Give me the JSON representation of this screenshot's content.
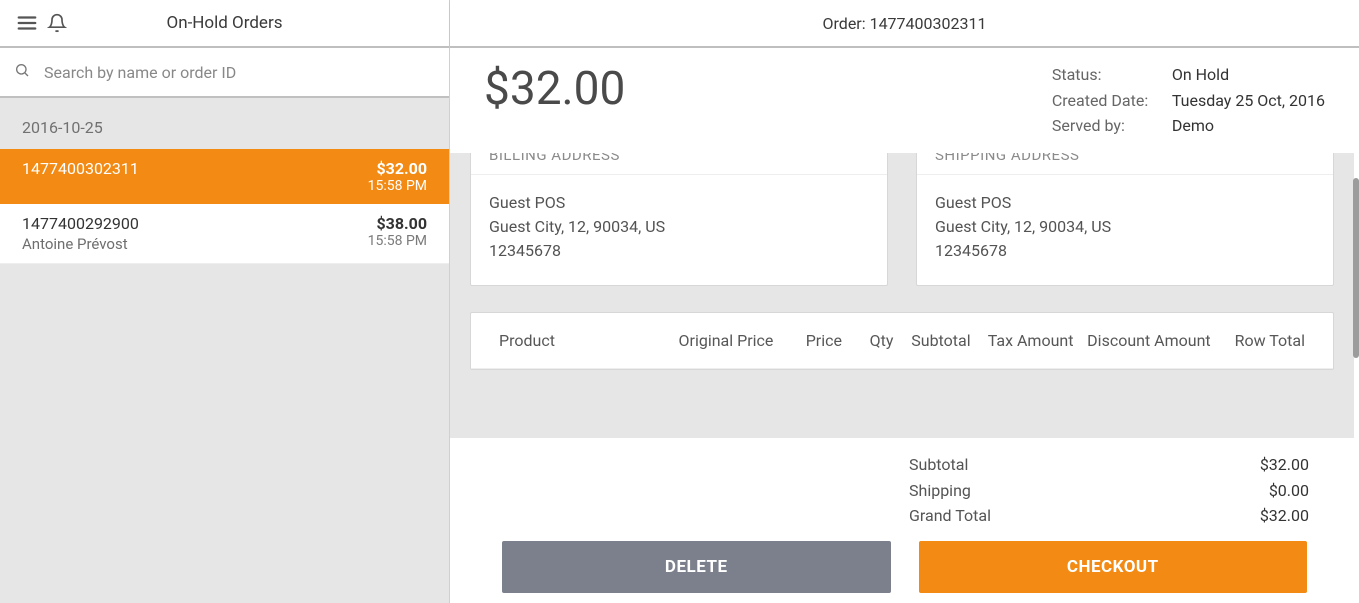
{
  "left": {
    "title": "On-Hold Orders",
    "search_placeholder": "Search by name or order ID",
    "date_group": "2016-10-25",
    "orders": [
      {
        "id": "1477400302311",
        "price": "$32.00",
        "time": "15:58 PM",
        "customer": ""
      },
      {
        "id": "1477400292900",
        "price": "$38.00",
        "time": "15:58 PM",
        "customer": "Antoine Prévost"
      }
    ]
  },
  "right": {
    "header": "Order: 1477400302311",
    "total": "$32.00",
    "meta": {
      "status_label": "Status:",
      "status_value": "On Hold",
      "created_label": "Created Date:",
      "created_value": "Tuesday 25 Oct, 2016",
      "served_label": "Served by:",
      "served_value": "Demo"
    },
    "billing": {
      "title": "BILLING ADDRESS",
      "name": "Guest POS",
      "line": "Guest City, 12, 90034, US",
      "phone": "12345678"
    },
    "shipping": {
      "title": "SHIPPING ADDRESS",
      "name": "Guest POS",
      "line": "Guest City, 12, 90034, US",
      "phone": "12345678"
    },
    "table_headers": {
      "product": "Product",
      "original_price": "Original Price",
      "price": "Price",
      "qty": "Qty",
      "subtotal": "Subtotal",
      "tax": "Tax Amount",
      "discount": "Discount Amount",
      "row_total": "Row Total"
    },
    "totals": {
      "subtotal_label": "Subtotal",
      "subtotal_value": "$32.00",
      "shipping_label": "Shipping",
      "shipping_value": "$0.00",
      "grand_label": "Grand Total",
      "grand_value": "$32.00"
    },
    "buttons": {
      "delete": "DELETE",
      "checkout": "CHECKOUT"
    }
  }
}
